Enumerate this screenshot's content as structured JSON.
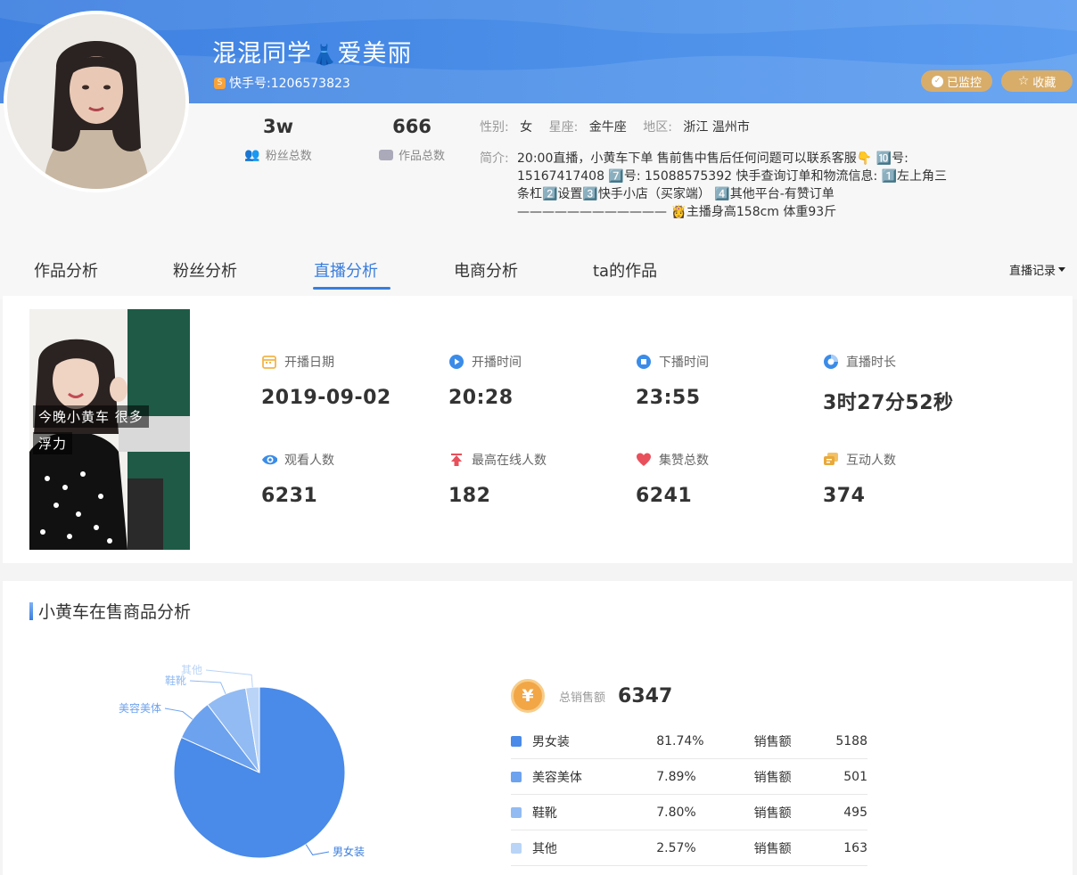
{
  "header": {
    "name_part1": "混混同学",
    "name_emoji": "👗",
    "name_part2": "爱美丽",
    "kuaishou_id": "快手号:1206573823",
    "btn_monitor": "已监控",
    "btn_favorite": "收藏"
  },
  "profile": {
    "fans_value": "3w",
    "fans_label": "粉丝总数",
    "works_value": "666",
    "works_label": "作品总数",
    "gender_label": "性别:",
    "gender_value": "女",
    "zodiac_label": "星座:",
    "zodiac_value": "金牛座",
    "region_label": "地区:",
    "region_value": "浙江 温州市",
    "bio_label": "简介:",
    "bio_value": "20:00直播，小黄车下单 售前售中售后任何问题可以联系客服👇 🔟号: 15167417408 7️⃣号: 15088575392 快手查询订单和物流信息: 1️⃣左上角三条杠2️⃣设置3️⃣快手小店（买家端） 4️⃣其他平台-有赞订单 ———————————— 👸主播身高158cm 体重93斤"
  },
  "tabs": [
    "作品分析",
    "粉丝分析",
    "直播分析",
    "电商分析",
    "ta的作品"
  ],
  "dropdown_label": "直播记录",
  "live": {
    "cover_caption_1": "今晚小黄车 很多",
    "cover_caption_2": "浮力",
    "metrics": [
      {
        "label": "开播日期",
        "value": "2019-09-02",
        "icon": "calendar-icon"
      },
      {
        "label": "开播时间",
        "value": "20:28",
        "icon": "play-icon"
      },
      {
        "label": "下播时间",
        "value": "23:55",
        "icon": "stop-icon"
      },
      {
        "label": "直播时长",
        "value": "3时27分52秒",
        "icon": "duration-icon"
      },
      {
        "label": "观看人数",
        "value": "6231",
        "icon": "eye-icon"
      },
      {
        "label": "最高在线人数",
        "value": "182",
        "icon": "peak-icon"
      },
      {
        "label": "集赞总数",
        "value": "6241",
        "icon": "heart-icon"
      },
      {
        "label": "互动人数",
        "value": "374",
        "icon": "chat-icon"
      }
    ]
  },
  "goods": {
    "title": "小黄车在售商品分析",
    "total_label": "总销售额",
    "total_value": "6347",
    "sales_label": "销售额",
    "rows": [
      {
        "name": "男女装",
        "percent": "81.74%",
        "amount": "5188",
        "color": "#4a8ae8"
      },
      {
        "name": "美容美体",
        "percent": "7.89%",
        "amount": "501",
        "color": "#6da2ef"
      },
      {
        "name": "鞋靴",
        "percent": "7.80%",
        "amount": "495",
        "color": "#92bbf3"
      },
      {
        "name": "其他",
        "percent": "2.57%",
        "amount": "163",
        "color": "#b9d4f7"
      }
    ]
  },
  "chart_data": {
    "type": "pie",
    "categories": [
      "男女装",
      "美容美体",
      "鞋靴",
      "其他"
    ],
    "values": [
      5188,
      501,
      495,
      163
    ],
    "colors": [
      "#4a8ae8",
      "#6da2ef",
      "#92bbf3",
      "#b9d4f7"
    ],
    "title": "小黄车在售商品分析"
  }
}
